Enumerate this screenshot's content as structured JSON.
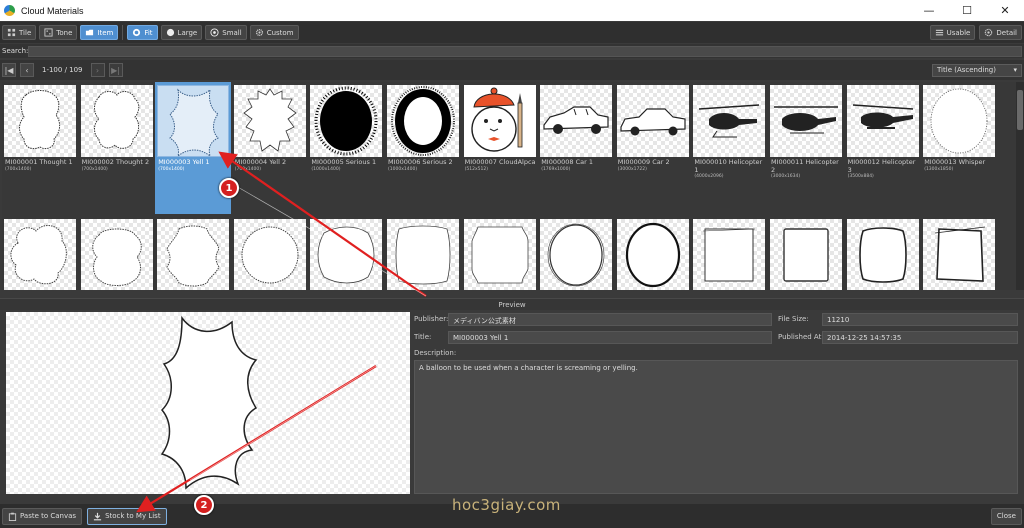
{
  "window": {
    "title": "Cloud Materials"
  },
  "toolbar": {
    "views": [
      {
        "label": "Tile",
        "icon": "tile-icon",
        "active": false
      },
      {
        "label": "Tone",
        "icon": "tone-icon",
        "active": false
      },
      {
        "label": "Item",
        "icon": "item-icon",
        "active": true
      }
    ],
    "sizes": [
      {
        "label": "Fit",
        "active": true
      },
      {
        "label": "Large",
        "active": false
      },
      {
        "label": "Small",
        "active": false
      },
      {
        "label": "Custom",
        "active": false
      }
    ],
    "usable_label": "Usable",
    "detail_label": "Detail"
  },
  "search": {
    "label": "Search:",
    "value": ""
  },
  "pagination": {
    "range_text": "1-100 / 109",
    "sort_value": "Title (Ascending)"
  },
  "materials_row1": [
    {
      "name": "MI000001 Thought 1",
      "size": "(700x1400)",
      "shape": "thought",
      "selected": false
    },
    {
      "name": "MI000002 Thought 2",
      "size": "(700x1400)",
      "shape": "thought2",
      "selected": false
    },
    {
      "name": "MI000003 Yell 1",
      "size": "(700x1400)",
      "shape": "yell",
      "selected": true
    },
    {
      "name": "MI000004 Yell 2",
      "size": "(700x1400)",
      "shape": "yell2",
      "selected": false
    },
    {
      "name": "MI000005 Serious 1",
      "size": "(1000x1400)",
      "shape": "serious",
      "selected": false
    },
    {
      "name": "MI000006 Serious 2",
      "size": "(1000x1400)",
      "shape": "serious2",
      "selected": false
    },
    {
      "name": "MI000007 CloudAlpca",
      "size": "(512x512)",
      "shape": "alpaca",
      "selected": false
    },
    {
      "name": "MI000008 Car 1",
      "size": "(1769x1000)",
      "shape": "car",
      "selected": false
    },
    {
      "name": "MI000009 Car 2",
      "size": "(3000x1722)",
      "shape": "car2",
      "selected": false
    },
    {
      "name": "MI000010 Helicopter 1",
      "size": "(4000x2096)",
      "shape": "heli",
      "selected": false
    },
    {
      "name": "MI000011 Helicopter 2",
      "size": "(3000x1634)",
      "shape": "heli2",
      "selected": false
    },
    {
      "name": "MI000012 Helicopter 3",
      "size": "(3500x884)",
      "shape": "heli3",
      "selected": false
    },
    {
      "name": "MI000013 Whisper",
      "size": "(1300x1850)",
      "shape": "whisper",
      "selected": false
    }
  ],
  "materials_row2": [
    {
      "shape": "blob"
    },
    {
      "shape": "blob2"
    },
    {
      "shape": "blob3"
    },
    {
      "shape": "round"
    },
    {
      "shape": "round2"
    },
    {
      "shape": "rect"
    },
    {
      "shape": "rect2"
    },
    {
      "shape": "oval"
    },
    {
      "shape": "oval2"
    },
    {
      "shape": "square"
    },
    {
      "shape": "square2"
    },
    {
      "shape": "square3"
    },
    {
      "shape": "square4"
    }
  ],
  "preview": {
    "header": "Preview",
    "publisher_label": "Publisher:",
    "publisher_value": "メディバン公式素材",
    "title_label": "Title:",
    "title_value": "MI000003 Yell 1",
    "file_size_label": "File Size:",
    "file_size_value": "11210",
    "published_label": "Published At:",
    "published_value": "2014-12-25 14:57:35",
    "description_label": "Description:",
    "description_value": "A balloon to be used when a character is screaming or yelling."
  },
  "bottom": {
    "paste_label": "Paste to Canvas",
    "stock_label": "Stock to My List",
    "close_label": "Close",
    "watermark": "hoc3giay.com"
  },
  "annotations": {
    "badge1": "1",
    "badge2": "2",
    "arrow_color": "#e02020"
  }
}
